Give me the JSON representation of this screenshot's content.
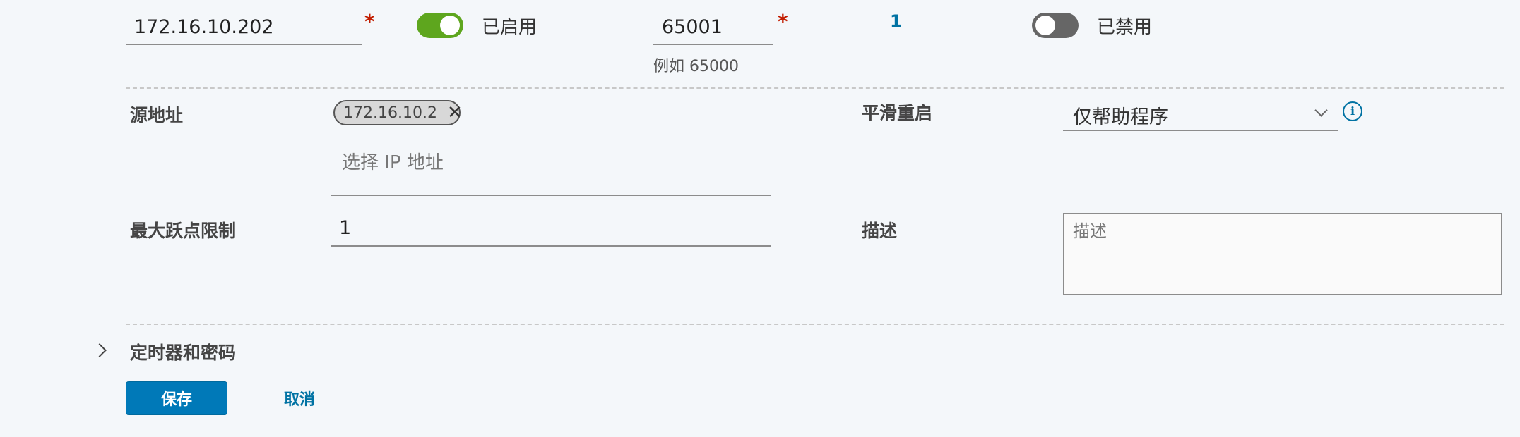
{
  "neighbor_row": {
    "ip_address": "172.16.10.202",
    "bfd_toggle_label": "已启用",
    "remote_as": "65001",
    "remote_as_hint": "例如 65000",
    "link_count": "1",
    "allowas_toggle_label": "已禁用"
  },
  "form": {
    "source_address_label": "源地址",
    "source_address_chip": "172.16.10.2",
    "source_address_placeholder": "选择 IP 地址",
    "graceful_restart_label": "平滑重启",
    "graceful_restart_value": "仅帮助程序",
    "max_hop_label": "最大跃点限制",
    "max_hop_value": "1",
    "description_label": "描述",
    "description_placeholder": "描述"
  },
  "section": {
    "timers_label": "定时器和密码"
  },
  "actions": {
    "save_label": "保存",
    "cancel_label": "取消"
  },
  "colors": {
    "accent": "#0079b8",
    "toggle_on": "#5ea61e",
    "toggle_off": "#666666",
    "required": "#c21d00",
    "background": "#f4f7fa"
  }
}
